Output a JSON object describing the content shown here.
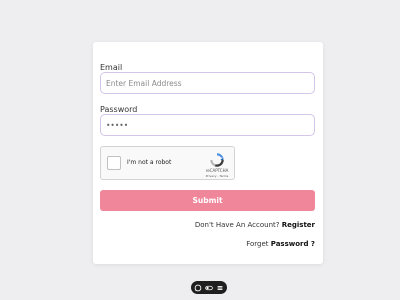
{
  "form": {
    "email_label": "Email",
    "email_placeholder": "Enter Email Address",
    "email_value": "",
    "password_label": "Password",
    "password_value": "•••••",
    "recaptcha": {
      "checkbox_label": "I'm not a robot",
      "brand": "reCAPTCHA",
      "terms": "Privacy - Terms"
    },
    "submit_label": "Submit",
    "register_prompt": "Don't Have An Account?",
    "register_link": "Register",
    "forgot_prompt": "Forget",
    "forgot_link": "Password ?"
  },
  "toolbar": {
    "icons": [
      "chat-icon",
      "toggle-icon",
      "menu-icon"
    ]
  },
  "colors": {
    "background": "#eeedef",
    "accent": "#f0869a",
    "input_border": "#d3c6e8"
  }
}
